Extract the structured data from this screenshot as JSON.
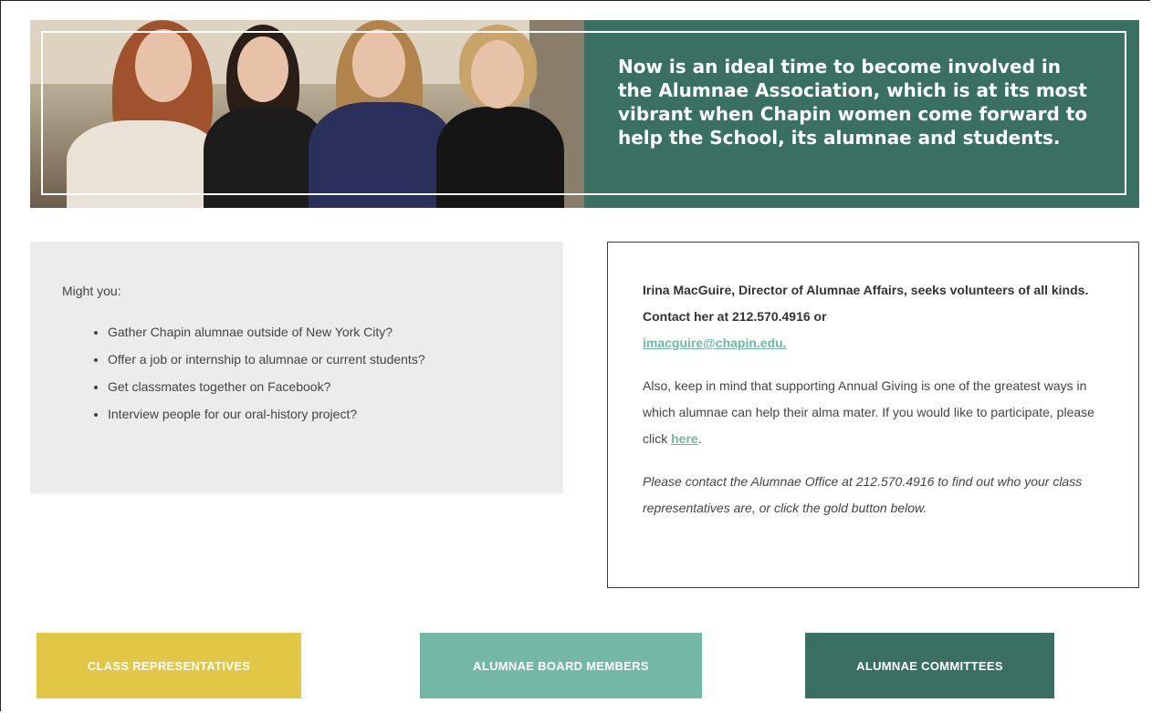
{
  "hero": {
    "text": "Now is an ideal time to become involved in the Alumnae Association, which is at its most vibrant when Chapin women come forward to help the School, its alumnae and students."
  },
  "might": {
    "intro": "Might you:",
    "items": [
      "Gather Chapin alumnae outside of New York City?",
      "Offer a job or internship to alumnae or current students?",
      "Get classmates together on Facebook?",
      "Interview people for our oral-history project?"
    ]
  },
  "info": {
    "contact_text": "Irina MacGuire, Director of Alumnae Affairs, seeks volunteers of all kinds. Contact her at 212.570.4916 or",
    "email_link": "imacguire@chapin.edu.",
    "giving_text": "Also, keep in mind that supporting Annual Giving is one of the greatest ways in which alumnae can help their alma mater. If you would like to participate, please click",
    "giving_link": "here",
    "giving_end": ".",
    "office_text": "Please contact the Alumnae Office at 212.570.4916 to find out who your class representatives are, or click the gold button below."
  },
  "buttons": {
    "class_reps": "CLASS REPRESENTATIVES",
    "board_members": "ALUMNAE BOARD MEMBERS",
    "committees": "ALUMNAE COMMITTEES"
  },
  "colors": {
    "green": "#3a7061",
    "gold": "#e1c745",
    "mint": "#73b8a4",
    "link": "#6fb8a3"
  }
}
